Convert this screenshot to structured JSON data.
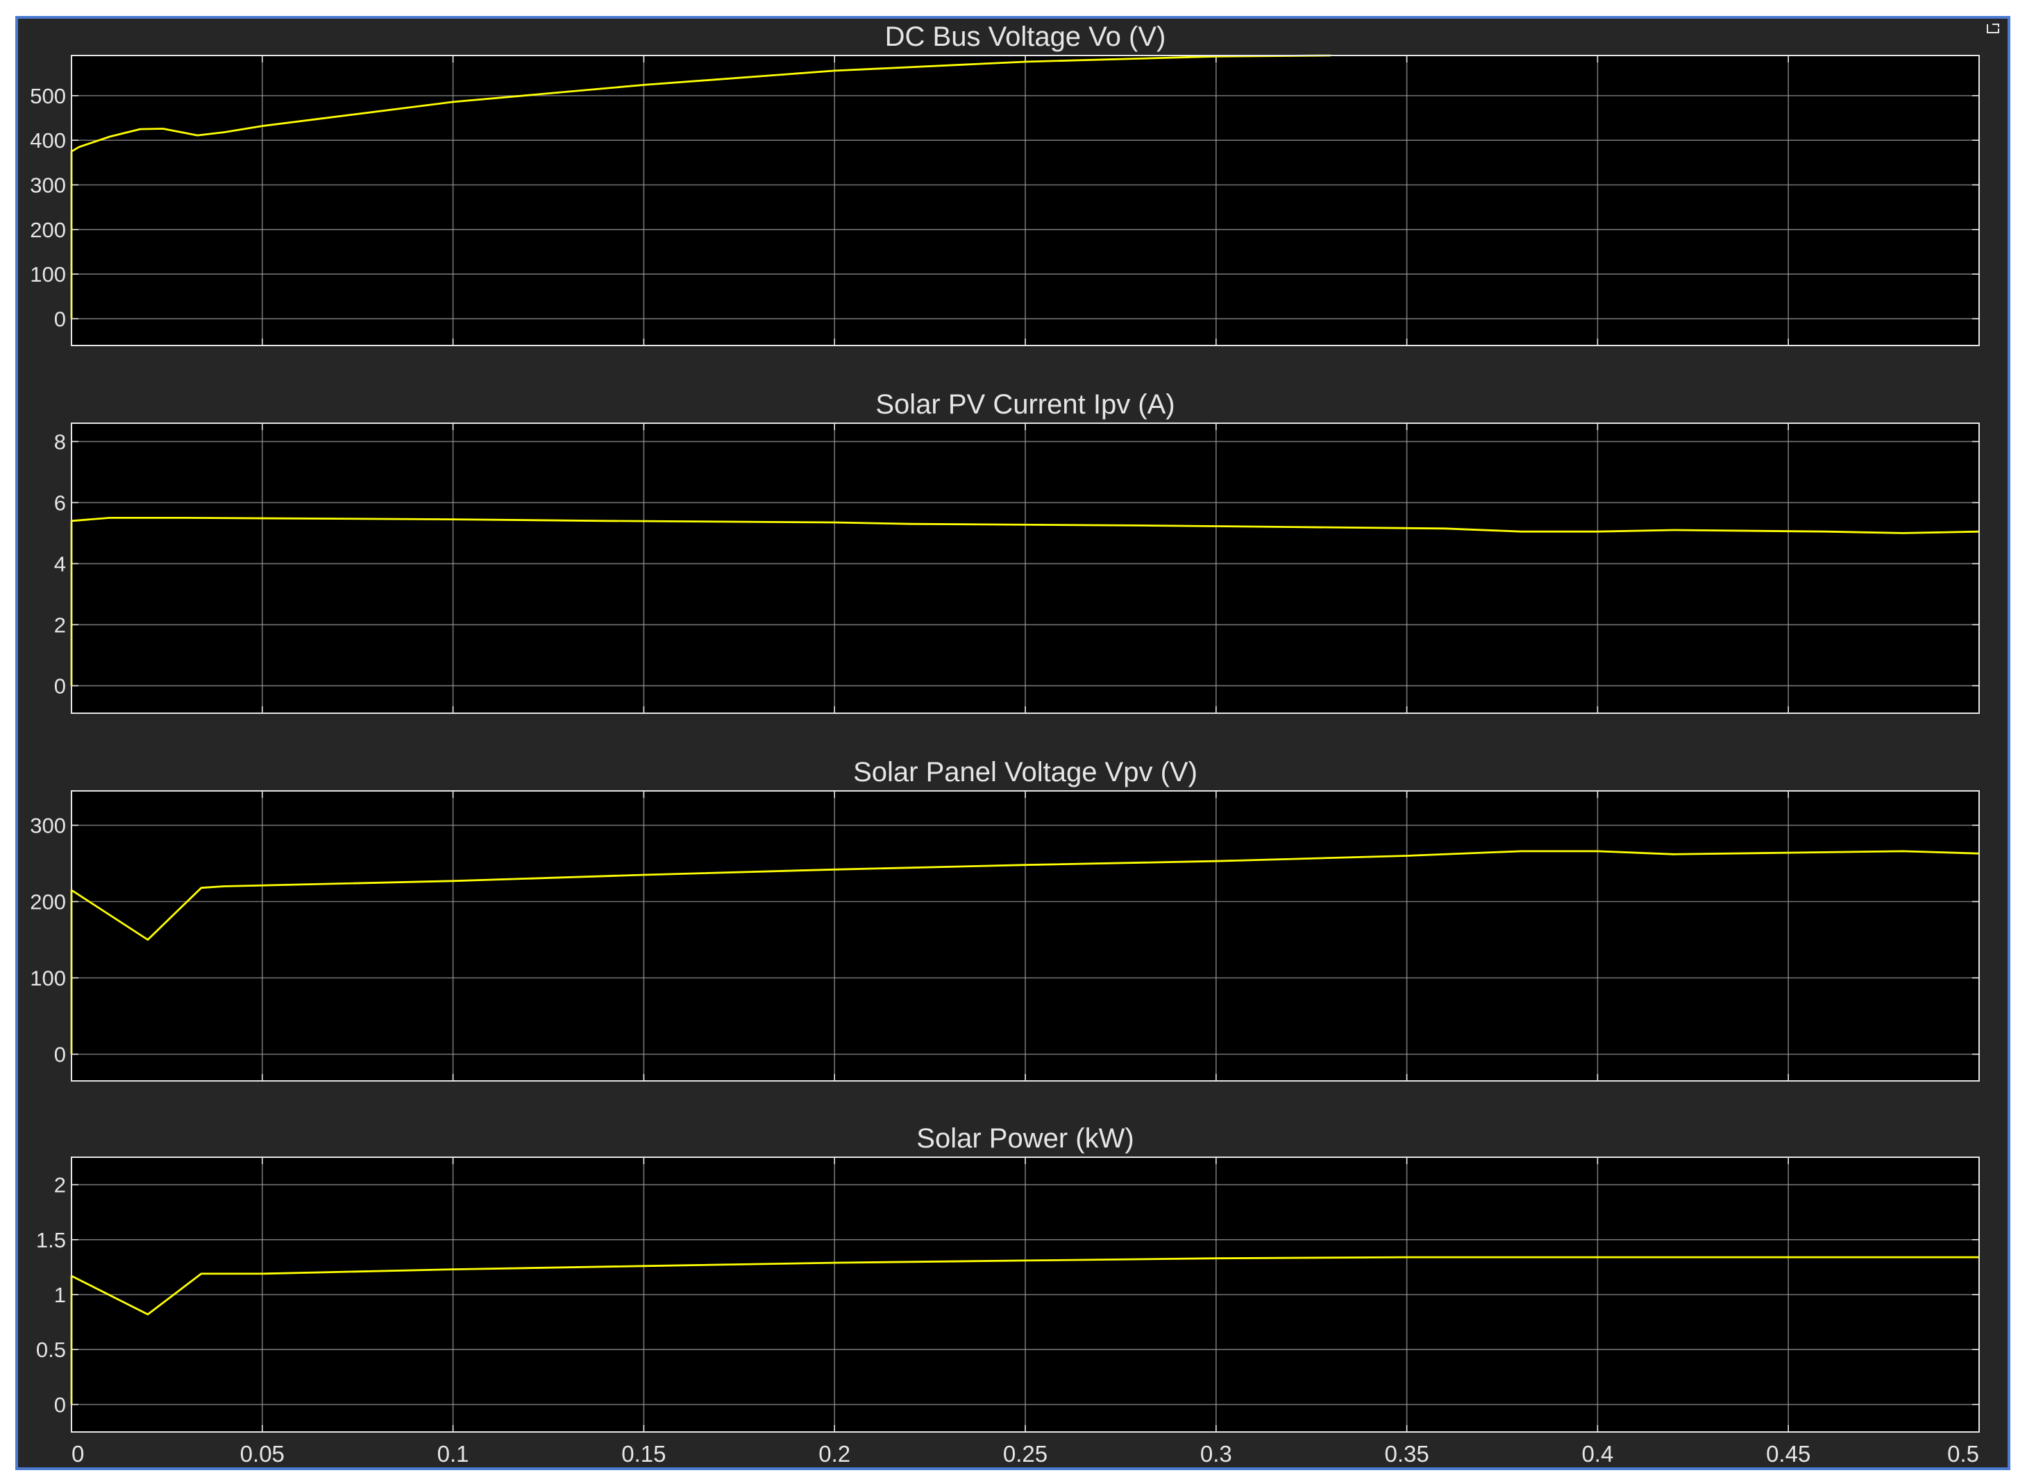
{
  "colors": {
    "figure_bg": "#262626",
    "axes_bg": "#000000",
    "grid": "#9a9a9a",
    "text": "#e6e6e6",
    "trace": "#ffff00",
    "frame_border": "#4a7bd0"
  },
  "icons": {
    "undock": "undock-icon"
  },
  "chart_data": [
    {
      "type": "line",
      "title": "DC Bus Voltage Vo (V)",
      "xlim": [
        0,
        0.5
      ],
      "ylim": [
        -60,
        590
      ],
      "yticks": [
        0,
        100,
        200,
        300,
        400,
        500
      ],
      "ytick_labels": [
        "0",
        "100",
        "200",
        "300",
        "400",
        "500"
      ],
      "xticks": [
        0,
        0.05,
        0.1,
        0.15,
        0.2,
        0.25,
        0.3,
        0.35,
        0.4,
        0.45,
        0.5
      ],
      "xtick_labels": [],
      "grid": true,
      "series": [
        {
          "x": [
            0,
            0,
            0.002,
            0.01,
            0.018,
            0.024,
            0.033,
            0.04,
            0.05,
            0.1,
            0.15,
            0.2,
            0.25,
            0.3,
            0.33
          ],
          "y": [
            0,
            375,
            385,
            408,
            425,
            426,
            411,
            418,
            432,
            486,
            524,
            556,
            576,
            588,
            590
          ]
        }
      ]
    },
    {
      "type": "line",
      "title": "Solar PV Current Ipv (A)",
      "xlim": [
        0,
        0.5
      ],
      "ylim": [
        -0.9,
        8.6
      ],
      "yticks": [
        0,
        2,
        4,
        6,
        8
      ],
      "ytick_labels": [
        "0",
        "2",
        "4",
        "6",
        "8"
      ],
      "xticks": [
        0,
        0.05,
        0.1,
        0.15,
        0.2,
        0.25,
        0.3,
        0.35,
        0.4,
        0.45,
        0.5
      ],
      "xtick_labels": [],
      "grid": true,
      "series": [
        {
          "x": [
            0,
            0,
            0.01,
            0.03,
            0.1,
            0.14,
            0.2,
            0.22,
            0.28,
            0.32,
            0.36,
            0.38,
            0.4,
            0.42,
            0.46,
            0.48,
            0.5
          ],
          "y": [
            0,
            5.4,
            5.5,
            5.5,
            5.45,
            5.4,
            5.35,
            5.3,
            5.25,
            5.2,
            5.15,
            5.05,
            5.05,
            5.1,
            5.05,
            5.0,
            5.05
          ]
        }
      ]
    },
    {
      "type": "line",
      "title": "Solar Panel Voltage Vpv (V)",
      "xlim": [
        0,
        0.5
      ],
      "ylim": [
        -35,
        345
      ],
      "yticks": [
        0,
        100,
        200,
        300
      ],
      "ytick_labels": [
        "0",
        "100",
        "200",
        "300"
      ],
      "xticks": [
        0,
        0.05,
        0.1,
        0.15,
        0.2,
        0.25,
        0.3,
        0.35,
        0.4,
        0.45,
        0.5
      ],
      "xtick_labels": [],
      "grid": true,
      "series": [
        {
          "x": [
            0,
            0,
            0.02,
            0.034,
            0.04,
            0.1,
            0.15,
            0.2,
            0.25,
            0.3,
            0.35,
            0.38,
            0.4,
            0.42,
            0.45,
            0.48,
            0.5
          ],
          "y": [
            0,
            215,
            150,
            218,
            220,
            227,
            235,
            242,
            248,
            253,
            260,
            266,
            266,
            262,
            264,
            266,
            263
          ]
        }
      ]
    },
    {
      "type": "line",
      "title": "Solar Power (kW)",
      "xlim": [
        0,
        0.5
      ],
      "ylim": [
        -0.25,
        2.25
      ],
      "yticks": [
        0,
        0.5,
        1,
        1.5,
        2
      ],
      "ytick_labels": [
        "0",
        "0.5",
        "1",
        "1.5",
        "2"
      ],
      "xticks": [
        0,
        0.05,
        0.1,
        0.15,
        0.2,
        0.25,
        0.3,
        0.35,
        0.4,
        0.45,
        0.5
      ],
      "xtick_labels": [
        "0",
        "0.05",
        "0.1",
        "0.15",
        "0.2",
        "0.25",
        "0.3",
        "0.35",
        "0.4",
        "0.45",
        "0.5"
      ],
      "grid": true,
      "series": [
        {
          "x": [
            0,
            0,
            0.02,
            0.034,
            0.05,
            0.1,
            0.15,
            0.2,
            0.25,
            0.3,
            0.35,
            0.4,
            0.45,
            0.5
          ],
          "y": [
            0,
            1.17,
            0.82,
            1.19,
            1.19,
            1.23,
            1.26,
            1.29,
            1.31,
            1.33,
            1.34,
            1.34,
            1.34,
            1.34
          ]
        }
      ]
    }
  ]
}
